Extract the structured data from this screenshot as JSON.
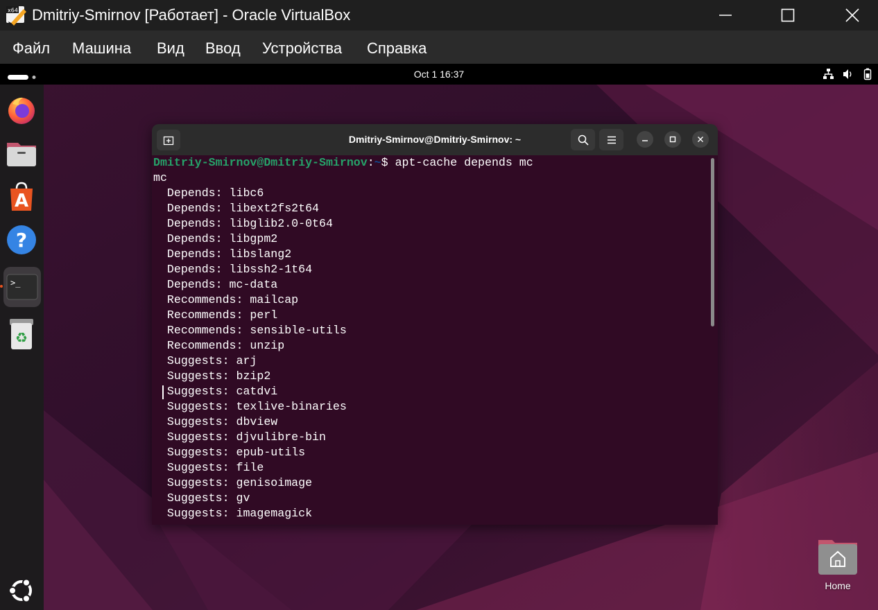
{
  "host_window": {
    "title": "Dmitriy-Smirnov [Работает] - Oracle VirtualBox",
    "app_badge": "x64"
  },
  "menubar": {
    "items": [
      "Файл",
      "Машина",
      "Вид",
      "Ввод",
      "Устройства",
      "Справка"
    ]
  },
  "guest_top_bar": {
    "clock": "Oct 1  16:37",
    "tray_icons": [
      "network-icon",
      "volume-icon",
      "battery-icon"
    ]
  },
  "dock": {
    "items": [
      {
        "name": "firefox",
        "icon": "firefox-icon"
      },
      {
        "name": "files",
        "icon": "files-icon"
      },
      {
        "name": "app-center",
        "icon": "app-center-icon"
      },
      {
        "name": "help",
        "icon": "help-icon"
      },
      {
        "name": "terminal",
        "icon": "terminal-icon",
        "active": true
      },
      {
        "name": "trash",
        "icon": "trash-icon"
      },
      {
        "name": "show-apps",
        "icon": "ubuntu-logo-icon"
      }
    ]
  },
  "terminal": {
    "title": "Dmitriy-Smirnov@Dmitriy-Smirnov: ~",
    "prompt_user": "Dmitriy-Smirnov@Dmitriy-Smirnov",
    "prompt_sep": ":",
    "prompt_path": "~",
    "prompt_symbol": "$ ",
    "command": "apt-cache depends mc",
    "output_lines": [
      "mc",
      "  Depends: libc6",
      "  Depends: libext2fs2t64",
      "  Depends: libglib2.0-0t64",
      "  Depends: libgpm2",
      "  Depends: libslang2",
      "  Depends: libssh2-1t64",
      "  Depends: mc-data",
      "  Recommends: mailcap",
      "  Recommends: perl",
      "  Recommends: sensible-utils",
      "  Recommends: unzip",
      "  Suggests: arj",
      "  Suggests: bzip2",
      "  Suggests: catdvi",
      "  Suggests: texlive-binaries",
      "  Suggests: dbview",
      "  Suggests: djvulibre-bin",
      "  Suggests: epub-utils",
      "  Suggests: file",
      "  Suggests: genisoimage",
      "  Suggests: gv",
      "  Suggests: imagemagick"
    ],
    "colors": {
      "background": "#300a24",
      "prompt_user": "#26a269",
      "prompt_path": "#12488b",
      "header": "#2c2c2c"
    }
  },
  "desktop": {
    "home_label": "Home",
    "colors": {
      "bg_dark": "#2a0f28",
      "bg_accent": "#6e1f4c"
    }
  }
}
